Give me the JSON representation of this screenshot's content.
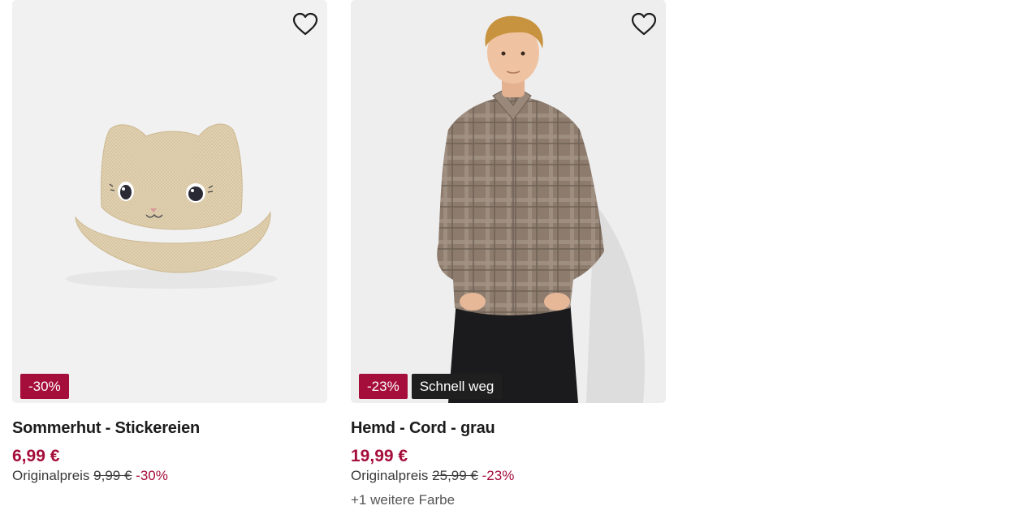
{
  "colors": {
    "accent": "#a50d3a",
    "flag_badge": "#1f1f1f",
    "title_text": "#1c1c1c"
  },
  "products": [
    {
      "name": "Sommerhut - Stickereien",
      "image_icon": "cat-ear-straw-hat",
      "wishlist_icon": "heart-outline-icon",
      "discount_badge": "-30%",
      "price": "6,99 €",
      "original_label": "Originalpreis",
      "original_price": "9,99 €",
      "discount_text": "-30%"
    },
    {
      "name": "Hemd - Cord - grau",
      "image_icon": "man-in-plaid-shirt",
      "wishlist_icon": "heart-outline-icon",
      "discount_badge": "-23%",
      "flag_badge": "Schnell weg",
      "price": "19,99 €",
      "original_label": "Originalpreis",
      "original_price": "25,99 €",
      "discount_text": "-23%",
      "more_colors": "+1 weitere Farbe"
    }
  ]
}
